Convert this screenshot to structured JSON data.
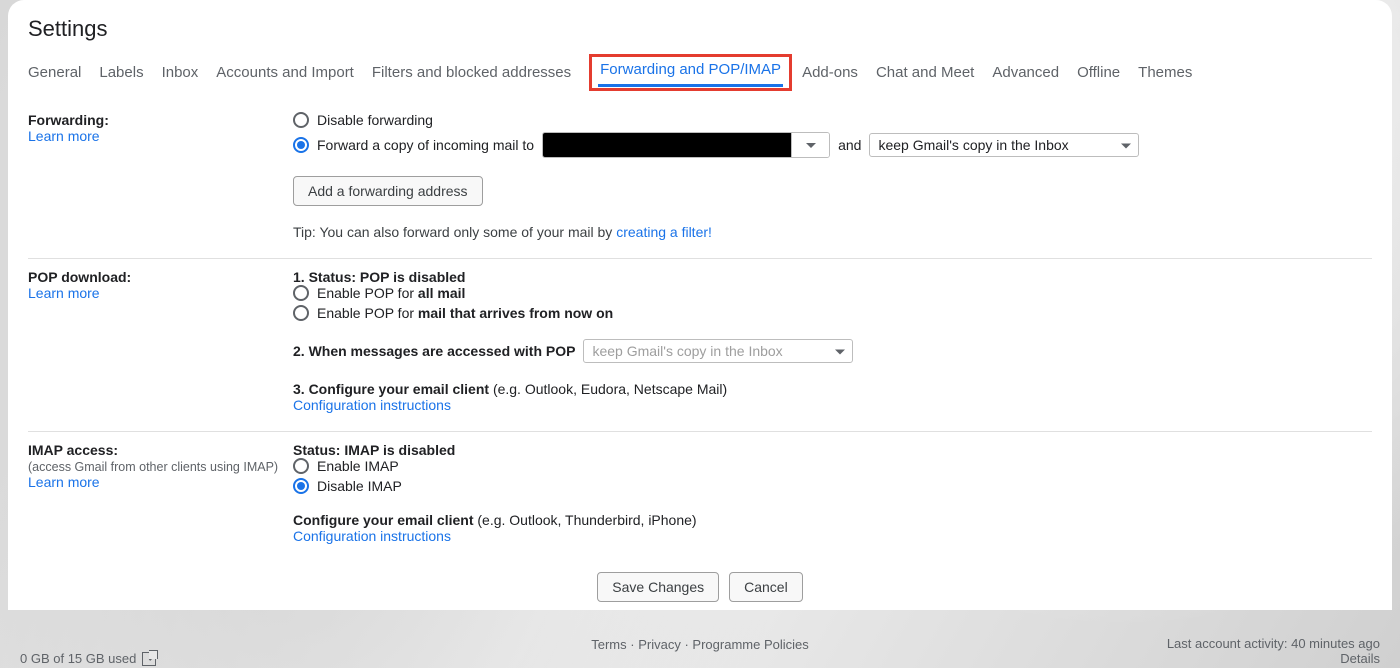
{
  "title": "Settings",
  "tabs": {
    "general": "General",
    "labels": "Labels",
    "inbox": "Inbox",
    "accounts": "Accounts and Import",
    "filters": "Filters and blocked addresses",
    "forwarding": "Forwarding and POP/IMAP",
    "addons": "Add-ons",
    "chat": "Chat and Meet",
    "advanced": "Advanced",
    "offline": "Offline",
    "themes": "Themes"
  },
  "forwarding": {
    "label": "Forwarding:",
    "learn_more": "Learn more",
    "disable": "Disable forwarding",
    "forward_copy": "Forward a copy of incoming mail to",
    "and": "and",
    "keep_copy": "keep Gmail's copy in the Inbox",
    "add_address_btn": "Add a forwarding address",
    "tip_prefix": "Tip: You can also forward only some of your mail by ",
    "tip_link": "creating a filter!"
  },
  "pop": {
    "label": "POP download:",
    "learn_more": "Learn more",
    "status_prefix": "1. Status: ",
    "status_value": "POP is disabled",
    "enable_all_prefix": "Enable POP for ",
    "enable_all_bold": "all mail",
    "enable_new_prefix": "Enable POP for ",
    "enable_new_bold": "mail that arrives from now on",
    "when_accessed": "2. When messages are accessed with POP",
    "when_select": "keep Gmail's copy in the Inbox",
    "configure_prefix": "3. Configure your email client ",
    "configure_hint": "(e.g. Outlook, Eudora, Netscape Mail)",
    "config_link": "Configuration instructions"
  },
  "imap": {
    "label": "IMAP access:",
    "subtitle": "(access Gmail from other clients using IMAP)",
    "learn_more": "Learn more",
    "status_prefix": "Status: ",
    "status_value": "IMAP is disabled",
    "enable": "Enable IMAP",
    "disable": "Disable IMAP",
    "configure_prefix": "Configure your email client ",
    "configure_hint": "(e.g. Outlook, Thunderbird, iPhone)",
    "config_link": "Configuration instructions"
  },
  "actions": {
    "save": "Save Changes",
    "cancel": "Cancel"
  },
  "footer": {
    "storage": "0 GB of 15 GB used",
    "terms": "Terms",
    "privacy": "Privacy",
    "policies": "Programme Policies",
    "activity": "Last account activity: 40 minutes ago",
    "details": "Details"
  }
}
